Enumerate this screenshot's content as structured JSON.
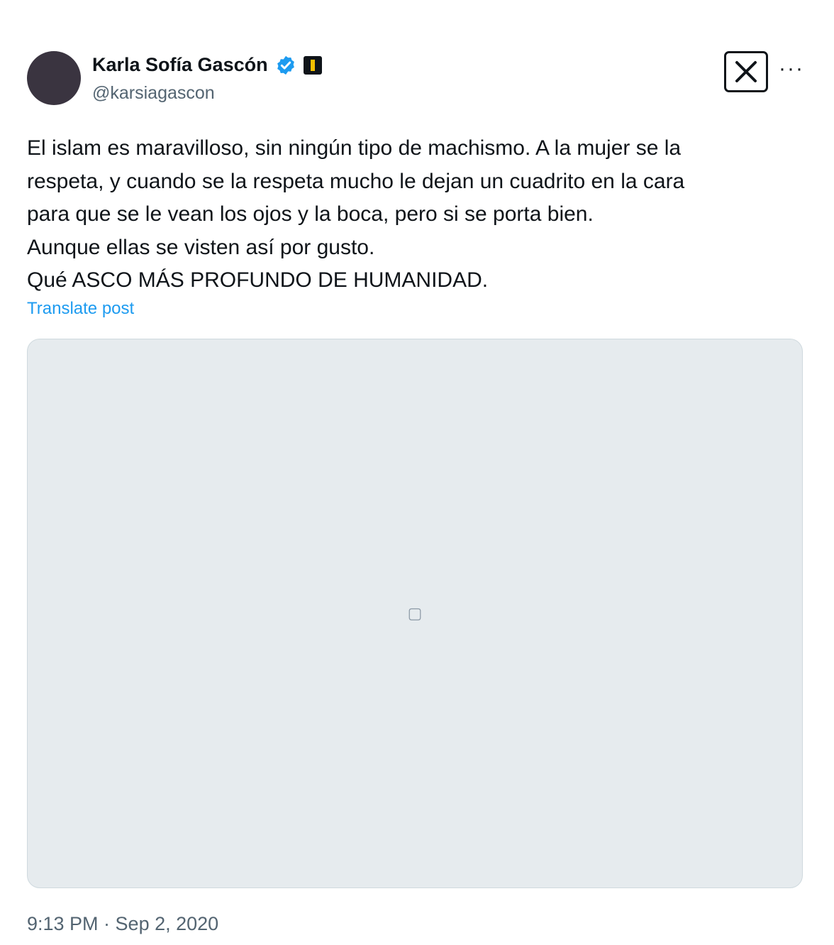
{
  "author": {
    "name": "Karla Sofía Gascón",
    "handle": "@karsiagascon"
  },
  "post": {
    "lines": [
      "El islam es maravilloso, sin ningún tipo de machismo. A la mujer se la",
      "respeta, y cuando se la respeta mucho le dejan un cuadrito en la cara",
      "para que se le vean los ojos y la boca, pero si se porta bien.",
      "Aunque ellas se visten así por gusto.",
      "Qué ASCO MÁS PROFUNDO DE HUMANIDAD."
    ],
    "translate_label": "Translate post",
    "timestamp": "9:13 PM · Sep 2, 2020"
  },
  "colors": {
    "accent": "#1d9bf0",
    "text": "#0f1419",
    "muted": "#536471"
  },
  "icons": [
    "verified-badge-icon",
    "affiliate-badge-icon",
    "x-logo-icon",
    "more-options-icon"
  ]
}
